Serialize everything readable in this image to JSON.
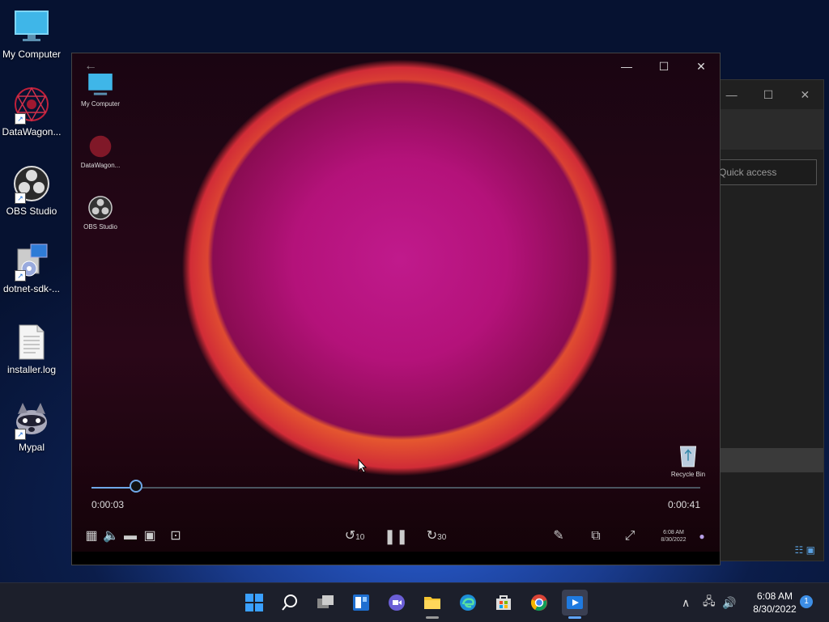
{
  "desktop": {
    "icons": [
      {
        "label": "My Computer"
      },
      {
        "label": "DataWagon..."
      },
      {
        "label": "OBS Studio"
      },
      {
        "label": "dotnet-sdk-..."
      },
      {
        "label": "installer.log"
      },
      {
        "label": "Mypal"
      }
    ]
  },
  "explorer_bg": {
    "search_placeholder": "Quick access",
    "minimize": "—",
    "maximize": "☐",
    "close": "✕"
  },
  "player": {
    "back": "←",
    "minimize": "—",
    "maximize": "☐",
    "close": "✕",
    "inner_icons": [
      {
        "label": "My Computer"
      },
      {
        "label": "DataWagon..."
      },
      {
        "label": "OBS Studio"
      },
      {
        "label": "Recycle Bin"
      }
    ],
    "current_time": "0:00:03",
    "total_time": "0:00:41",
    "progress_fraction": 0.073,
    "skip_back_label": "10",
    "skip_forward_label": "30",
    "pause_glyph": "❚❚",
    "inner_clock_time": "6:08 AM",
    "inner_clock_date": "8/30/2022"
  },
  "taskbar": {
    "clock_time": "6:08 AM",
    "clock_date": "8/30/2022",
    "notification_count": "1",
    "tray_chevron": "∧",
    "volume_glyph": "🔊",
    "network_glyph": "🖧"
  },
  "colors": {
    "accent": "#60a5ff",
    "seek_fill": "#6fa8e8"
  }
}
